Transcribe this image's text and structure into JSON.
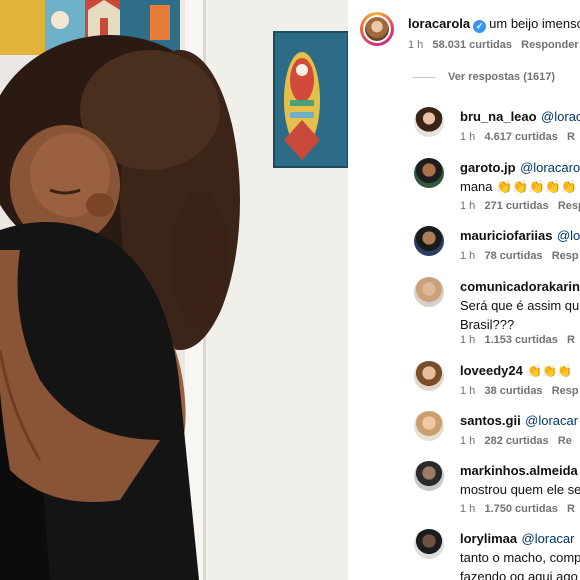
{
  "post": {
    "author": "loracarola",
    "caption": "um beijo imensos",
    "time": "1 h",
    "likes": "58.031 curtidas",
    "reply_label": "Responder"
  },
  "view_replies": "Ver respostas (1617)",
  "comments": [
    {
      "user": "bru_na_leao",
      "lines": [
        "@loraca"
      ],
      "time": "1 h",
      "likes": "4.617 curtidas",
      "reply": "R"
    },
    {
      "user": "garoto.jp",
      "lines": [
        "@loracarola",
        "mana 👏👏👏👏👏"
      ],
      "time": "1 h",
      "likes": "271 curtidas",
      "reply": "Resp"
    },
    {
      "user": "mauriciofariias",
      "lines": [
        "@lo"
      ],
      "time": "1 h",
      "likes": "78 curtidas",
      "reply": "Resp"
    },
    {
      "user": "comunicadorakarin",
      "lines": [
        "",
        "Será que é assim qu",
        "Brasil???"
      ],
      "time": "1 h",
      "likes": "1.153 curtidas",
      "reply": "R"
    },
    {
      "user": "loveedy24",
      "lines": [
        "👏👏👏"
      ],
      "time": "1 h",
      "likes": "38 curtidas",
      "reply": "Resp"
    },
    {
      "user": "santos.gii",
      "lines": [
        "@loracar"
      ],
      "time": "1 h",
      "likes": "282 curtidas",
      "reply": "Re"
    },
    {
      "user": "markinhos.almeida",
      "lines": [
        "",
        "mostrou quem ele se"
      ],
      "time": "1 h",
      "likes": "1.750 curtidas",
      "reply": "R"
    },
    {
      "user": "lorylimaa",
      "lines": [
        "@loracar",
        "tanto o macho, comp",
        "fazendo oq aqui ago"
      ],
      "time": "",
      "likes": "",
      "reply": ""
    }
  ]
}
